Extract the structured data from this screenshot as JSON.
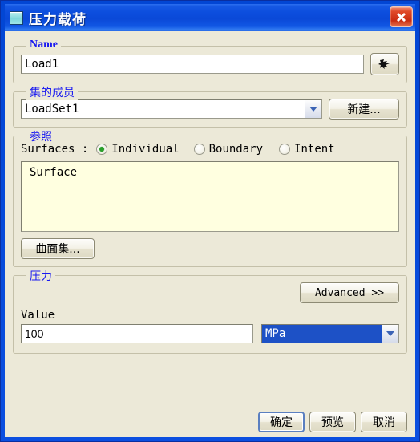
{
  "window": {
    "title": "压力载荷",
    "title_icon": "pressure-load-icon",
    "close_label": "✕",
    "frame_color": "#0a49d8",
    "body_color": "#ece9d8"
  },
  "name_group": {
    "legend": "Name",
    "value": "Load1",
    "picker_icon": "surface-blob-icon"
  },
  "set_group": {
    "legend": "集的成员",
    "selected": "LoadSet1",
    "new_button": "新建..."
  },
  "reference_group": {
    "legend": "参照",
    "surfaces_label": "Surfaces :",
    "options": [
      {
        "label": "Individual",
        "checked": true
      },
      {
        "label": "Boundary",
        "checked": false
      },
      {
        "label": "Intent",
        "checked": false
      }
    ],
    "list_items": [
      "Surface"
    ],
    "surface_set_button": "曲面集..."
  },
  "pressure_group": {
    "legend": "压力",
    "advanced_button": "Advanced >>",
    "value_label": "Value",
    "value": "100",
    "unit": "MPa",
    "unit_highlight_color": "#1d51c6"
  },
  "footer": {
    "ok": "确定",
    "preview": "预览",
    "cancel": "取消"
  }
}
